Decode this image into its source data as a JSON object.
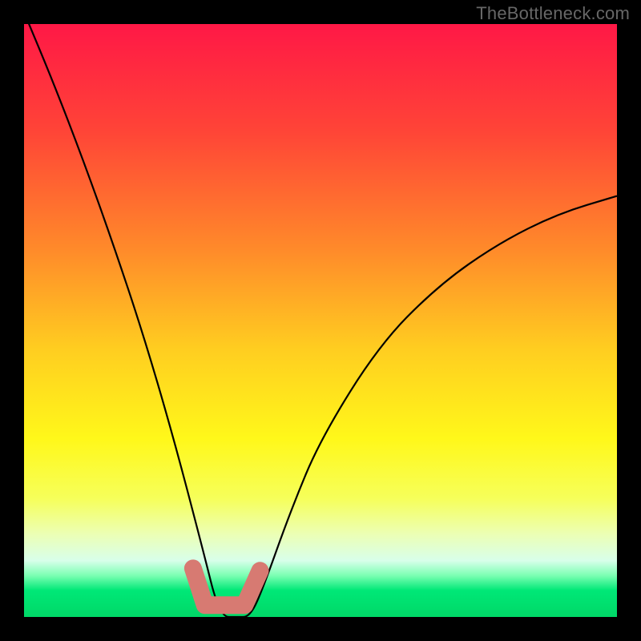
{
  "watermark": "TheBottleneck.com",
  "colors": {
    "accent_salmon": "#d77a72",
    "curve_stroke": "#000000",
    "gradient_stops": [
      {
        "offset": 0.0,
        "color": "#ff1846"
      },
      {
        "offset": 0.18,
        "color": "#ff4437"
      },
      {
        "offset": 0.38,
        "color": "#ff8a2a"
      },
      {
        "offset": 0.55,
        "color": "#ffce20"
      },
      {
        "offset": 0.7,
        "color": "#fff81a"
      },
      {
        "offset": 0.8,
        "color": "#f6ff5a"
      },
      {
        "offset": 0.86,
        "color": "#ecffb4"
      },
      {
        "offset": 0.905,
        "color": "#d8ffea"
      },
      {
        "offset": 0.93,
        "color": "#7cffb3"
      },
      {
        "offset": 0.955,
        "color": "#00e877"
      },
      {
        "offset": 1.0,
        "color": "#00d867"
      }
    ]
  },
  "chart_data": {
    "type": "line",
    "title": "",
    "xlabel": "",
    "ylabel": "",
    "x": [
      0.0,
      0.05,
      0.1,
      0.15,
      0.2,
      0.25,
      0.3,
      0.33,
      0.36,
      0.38,
      0.4,
      0.45,
      0.5,
      0.6,
      0.7,
      0.8,
      0.9,
      1.0
    ],
    "values": [
      1.02,
      0.9,
      0.77,
      0.63,
      0.48,
      0.31,
      0.12,
      0.0,
      0.0,
      0.0,
      0.04,
      0.18,
      0.3,
      0.46,
      0.56,
      0.63,
      0.68,
      0.71
    ],
    "xlim": [
      0,
      1
    ],
    "ylim": [
      0,
      1
    ],
    "notes": "V-shaped bottleneck curve; minimum (zero) occurs roughly between x≈0.33 and x≈0.38. Values are fractions of plot height from bottom; axes are unlabeled in the source image so units are normalized."
  }
}
